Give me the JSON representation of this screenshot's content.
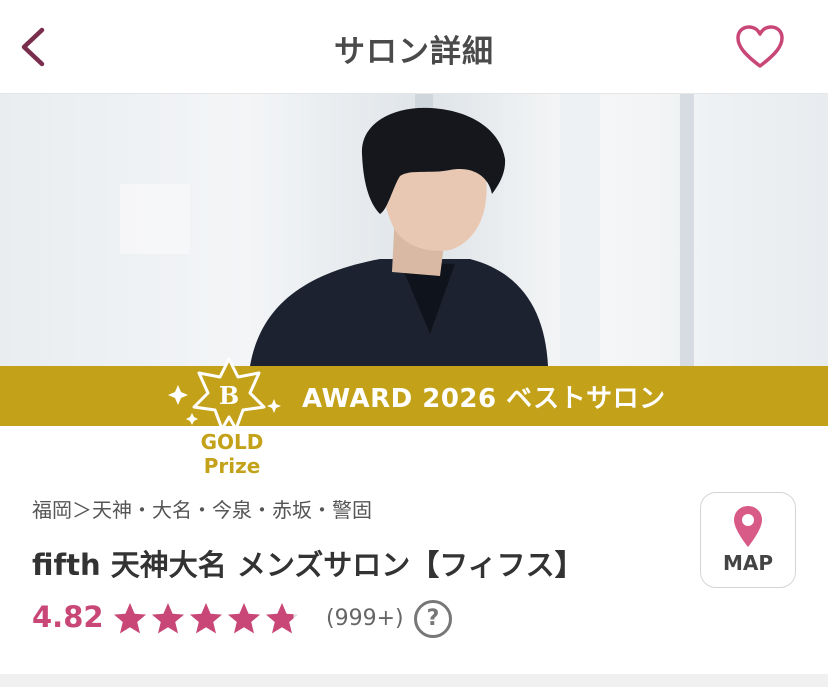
{
  "header": {
    "title": "サロン詳細",
    "back_icon": "chevron-left-icon",
    "favorite_icon": "heart-outline-icon"
  },
  "hero": {
    "image": "salon-hero-photo"
  },
  "award": {
    "text": "AWARD 2026 ベストサロン",
    "badge_letter": "B",
    "gold_label": "GOLD Prize",
    "band_color": "#c3a21a"
  },
  "salon": {
    "area": "福岡＞天神・大名・今泉・赤坂・警固",
    "name": "fifth 天神大名 メンズサロン【フィフス】",
    "rating": "4.82",
    "rating_value": 4.82,
    "review_count": "(999+)",
    "help_symbol": "?"
  },
  "map_button": {
    "label": "MAP",
    "icon": "map-pin-icon"
  },
  "colors": {
    "accent": "#c94776",
    "gold": "#c3a21a"
  }
}
